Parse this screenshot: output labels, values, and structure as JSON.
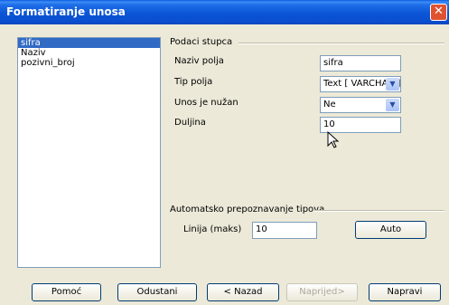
{
  "window": {
    "title": "Formatiranje unosa"
  },
  "list": {
    "items": [
      "sifra",
      "Naziv",
      "pozivni_broj"
    ],
    "selected": "sifra"
  },
  "column_group": {
    "title": "Podaci stupca",
    "field_name_label": "Naziv polja",
    "field_name_value": "sifra",
    "field_type_label": "Tip polja",
    "field_type_value": "Text [ VARCHAR ]",
    "required_label": "Unos je nužan",
    "required_value": "Ne",
    "length_label": "Duljina",
    "length_value": "10"
  },
  "auto_group": {
    "title": "Automatsko prepoznavanje tipova",
    "lines_label": "Linija (maks)",
    "lines_value": "10",
    "auto_button": "Auto"
  },
  "buttons": {
    "help": "Pomoć",
    "cancel": "Odustani",
    "back": "< Nazad",
    "next": "Naprijed>",
    "finish": "Napravi"
  },
  "colors": {
    "selection": "#316ac5",
    "title_bar": "#0a5ce4"
  },
  "icons": {
    "close": "close-icon",
    "dropdown": "chevron-down-icon",
    "pointer": "mouse-pointer-icon"
  }
}
